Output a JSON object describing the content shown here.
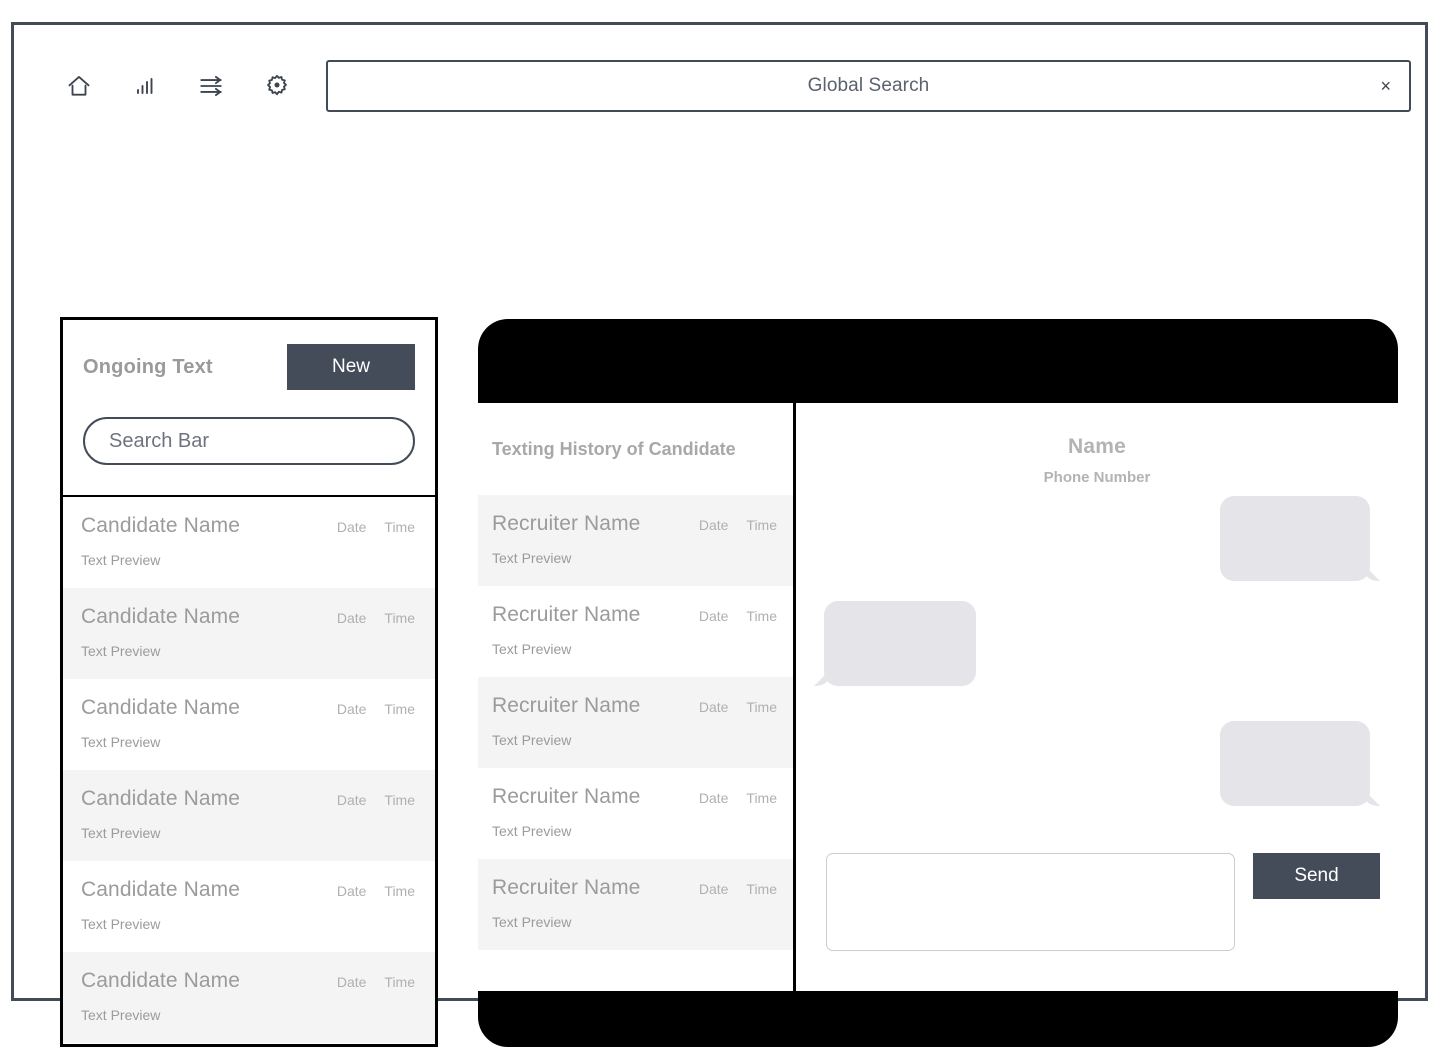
{
  "header": {
    "icons": [
      {
        "name": "home-icon",
        "label": "Home"
      },
      {
        "name": "bar-chart-icon",
        "label": "Analytics"
      },
      {
        "name": "filters-icon",
        "label": "Filters"
      },
      {
        "name": "gear-icon",
        "label": "Settings"
      }
    ],
    "search": {
      "text": "Global Search",
      "clear_label": "×"
    }
  },
  "left_panel": {
    "title": "Ongoing Text",
    "new_button": "New",
    "search_placeholder": "Search Bar",
    "rows": [
      {
        "name": "Candidate Name",
        "date": "Date",
        "time": "Time",
        "preview": "Text Preview"
      },
      {
        "name": "Candidate Name",
        "date": "Date",
        "time": "Time",
        "preview": "Text Preview"
      },
      {
        "name": "Candidate Name",
        "date": "Date",
        "time": "Time",
        "preview": "Text Preview"
      },
      {
        "name": "Candidate Name",
        "date": "Date",
        "time": "Time",
        "preview": "Text Preview"
      },
      {
        "name": "Candidate Name",
        "date": "Date",
        "time": "Time",
        "preview": "Text Preview"
      },
      {
        "name": "Candidate Name",
        "date": "Date",
        "time": "Time",
        "preview": "Text Preview"
      }
    ]
  },
  "history_panel": {
    "title": "Texting History of Candidate",
    "rows": [
      {
        "name": "Recruiter Name",
        "date": "Date",
        "time": "Time",
        "preview": "Text Preview"
      },
      {
        "name": "Recruiter Name",
        "date": "Date",
        "time": "Time",
        "preview": "Text Preview"
      },
      {
        "name": "Recruiter Name",
        "date": "Date",
        "time": "Time",
        "preview": "Text Preview"
      },
      {
        "name": "Recruiter Name",
        "date": "Date",
        "time": "Time",
        "preview": "Text Preview"
      },
      {
        "name": "Recruiter Name",
        "date": "Date",
        "time": "Time",
        "preview": "Text Preview"
      }
    ]
  },
  "chat_panel": {
    "name": "Name",
    "phone": "Phone Number",
    "bubbles": [
      {
        "side": "out",
        "text": ""
      },
      {
        "side": "in",
        "text": ""
      },
      {
        "side": "out",
        "text": ""
      }
    ],
    "message_value": "",
    "message_placeholder": "",
    "send_button": "Send"
  },
  "colors": {
    "accent": "#454c59",
    "frame": "#434b58",
    "muted_text": "#9b9b9b",
    "row_alt": "#f4f4f4",
    "bubble": "#e5e5e9",
    "device": "#000000"
  }
}
